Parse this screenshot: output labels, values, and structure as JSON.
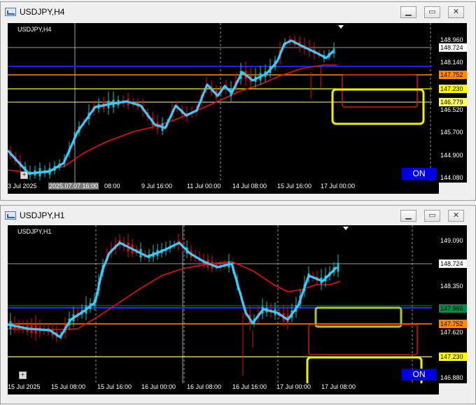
{
  "windows": [
    {
      "title": "USDJPY,H4",
      "symbol_label": "USDJPY,H4",
      "on_label": "ON",
      "price_labels": [
        "148.960",
        "148.140",
        "146.520",
        "145.700",
        "144.900",
        "144.080"
      ],
      "price_tags": [
        {
          "text": "148.724",
          "bg": "#ffffff",
          "fg": "#000000"
        },
        {
          "text": "147.752",
          "bg": "#ff8c00",
          "fg": "#000000"
        },
        {
          "text": "147.230",
          "bg": "#ffff00",
          "fg": "#000000"
        },
        {
          "text": "146.779",
          "bg": "#ffff66",
          "fg": "#000000"
        }
      ],
      "time_labels": [
        "3 Jul 2025",
        "2025.07.07 16:00",
        "9 Jul 16:00",
        "11 Jul 00:00",
        "14 Jul 08:00",
        "15 Jul 16:00",
        "17 Jul 00:00"
      ],
      "time_partial": "08:00"
    },
    {
      "title": "USDJPY,H1",
      "symbol_label": "USDJPY,H1",
      "on_label": "ON",
      "price_labels": [
        "149.090",
        "148.350",
        "147.620",
        "146.880"
      ],
      "price_tags": [
        {
          "text": "148.724",
          "bg": "#ffffff",
          "fg": "#000000"
        },
        {
          "text": "147.966",
          "bg": "#0a8a4a",
          "fg": "#000000"
        },
        {
          "text": "147.752",
          "bg": "#ff8c00",
          "fg": "#000000"
        },
        {
          "text": "147.230",
          "bg": "#ffff00",
          "fg": "#000000"
        }
      ],
      "time_labels": [
        "15 Jul 2025",
        "15 Jul 08:00",
        "15 Jul 16:00",
        "16 Jul 00:00",
        "16 Jul 08:00",
        "16 Jul 16:00",
        "17 Jul 00:00",
        "17 Jul 08:00"
      ]
    }
  ],
  "window_buttons": {
    "minimize": "▁",
    "restore": "▭",
    "close": "✕"
  },
  "colors": {
    "bull_candle": "#20c0c0",
    "bear_candle": "#e01010",
    "fast_ma": "#40c8ff",
    "slow_ma": "#e81010",
    "blue_line": "#1020ff",
    "orange_line": "#ff8c00",
    "yellow_line": "#ffff00",
    "zone_red": "#d01818",
    "zone_yellow": "#f0f000",
    "zone_green": "#a0c840"
  }
}
